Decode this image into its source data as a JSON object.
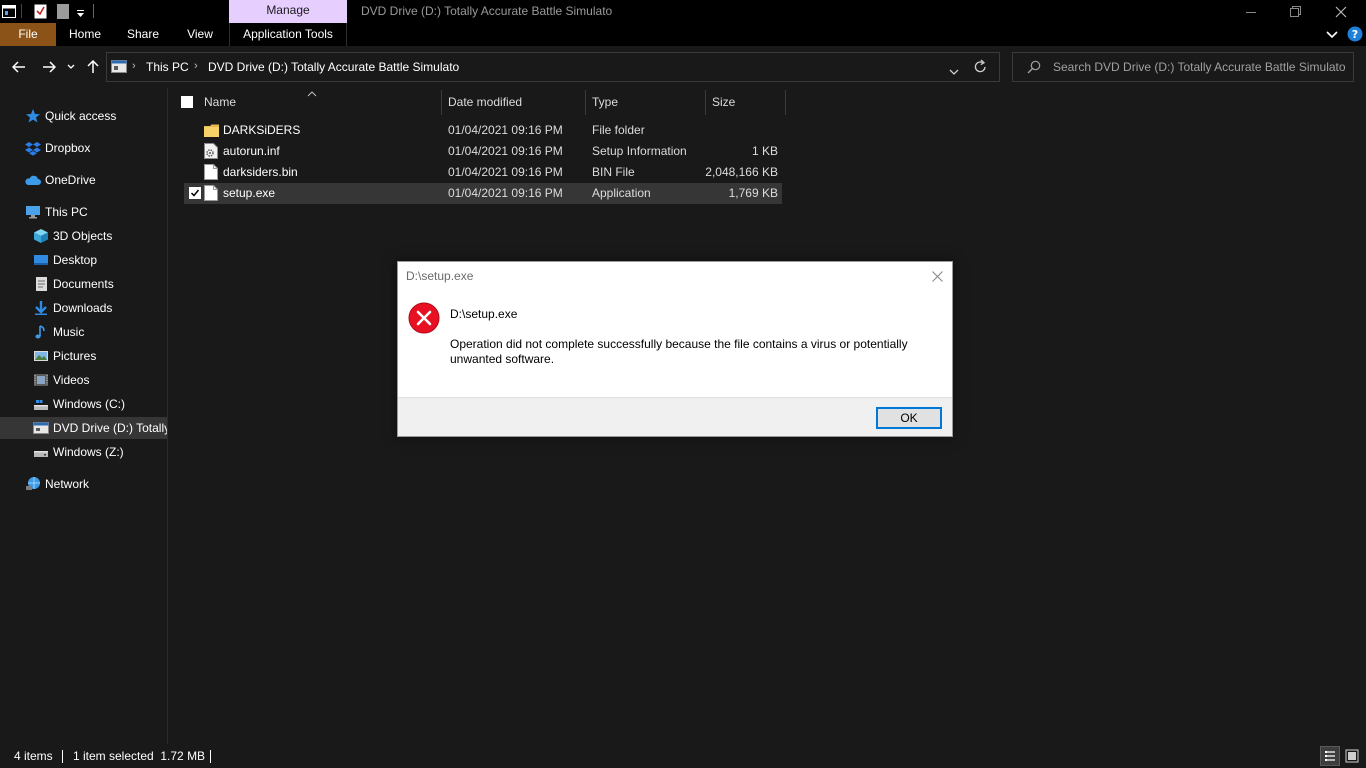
{
  "window": {
    "title": "DVD Drive (D:) Totally Accurate Battle Simulato",
    "context_tab": "Manage"
  },
  "ribbon": {
    "tabs": [
      "File",
      "Home",
      "Share",
      "View",
      "Application Tools"
    ]
  },
  "address": {
    "crumbs": [
      "This PC",
      "DVD Drive (D:) Totally Accurate Battle Simulato"
    ]
  },
  "search": {
    "placeholder": "Search DVD Drive (D:) Totally Accurate Battle Simulato"
  },
  "sidebar": {
    "items": [
      {
        "label": "Quick access",
        "icon": "star-icon"
      },
      {
        "label": "Dropbox",
        "icon": "dropbox-icon"
      },
      {
        "label": "OneDrive",
        "icon": "cloud-icon"
      },
      {
        "label": "This PC",
        "icon": "computer-icon"
      },
      {
        "label": "3D Objects",
        "icon": "cube-icon"
      },
      {
        "label": "Desktop",
        "icon": "desktop-icon"
      },
      {
        "label": "Documents",
        "icon": "document-icon"
      },
      {
        "label": "Downloads",
        "icon": "download-icon"
      },
      {
        "label": "Music",
        "icon": "music-icon"
      },
      {
        "label": "Pictures",
        "icon": "picture-icon"
      },
      {
        "label": "Videos",
        "icon": "video-icon"
      },
      {
        "label": "Windows (C:)",
        "icon": "drive-icon"
      },
      {
        "label": "DVD Drive (D:) Totally",
        "icon": "dvd-drive-icon"
      },
      {
        "label": "Windows (Z:)",
        "icon": "drive-icon"
      },
      {
        "label": "Network",
        "icon": "network-icon"
      }
    ],
    "selected": "DVD Drive (D:) Totally"
  },
  "file_list": {
    "columns": [
      "Name",
      "Date modified",
      "Type",
      "Size"
    ],
    "rows": [
      {
        "name": "DARKSiDERS",
        "date": "01/04/2021 09:16 PM",
        "type": "File folder",
        "size": "",
        "icon": "folder-icon",
        "selected": false
      },
      {
        "name": "autorun.inf",
        "date": "01/04/2021 09:16 PM",
        "type": "Setup Information",
        "size": "1 KB",
        "icon": "settings-file-icon",
        "selected": false
      },
      {
        "name": "darksiders.bin",
        "date": "01/04/2021 09:16 PM",
        "type": "BIN File",
        "size": "2,048,166 KB",
        "icon": "file-icon",
        "selected": false
      },
      {
        "name": "setup.exe",
        "date": "01/04/2021 09:16 PM",
        "type": "Application",
        "size": "1,769 KB",
        "icon": "file-icon",
        "selected": true
      }
    ]
  },
  "status": {
    "item_count": "4 items",
    "selection": "1 item selected  1.72 MB"
  },
  "dialog": {
    "title": "D:\\setup.exe",
    "heading": "D:\\setup.exe",
    "message": "Operation did not complete successfully because the file contains a virus or potentially unwanted software.",
    "ok_label": "OK",
    "icon": "error-icon"
  },
  "colors": {
    "file_tab": "#8b5318",
    "manage_tab": "#e6ceff",
    "accent": "#0078d7",
    "error": "#e81123",
    "background": "#191919",
    "selection": "#363636"
  }
}
